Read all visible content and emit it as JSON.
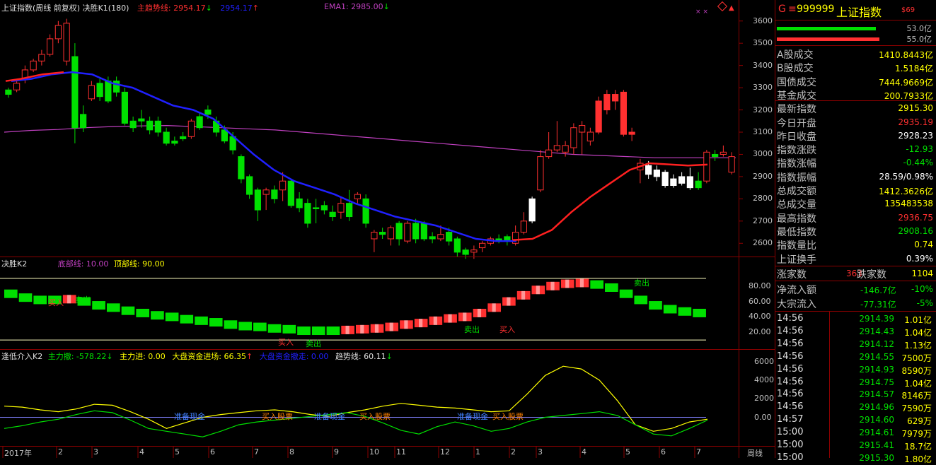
{
  "colors": {
    "up": "#ff3030",
    "down": "#00e000",
    "blue": "#2020ff",
    "magenta": "#c040c0",
    "yellow": "#ffff00",
    "grid": "#8b0000"
  },
  "main": {
    "title": "上证指数(周线 前复权) 决胜K1(180)",
    "trend_label": "主趋势线: 2954.17",
    "trend_arrow": "↓",
    "blue_label": "2954.17",
    "blue_arrow": "↑",
    "ema_label": "EMA1: 2985.00",
    "ema_arrow": "↓",
    "marker": "× ×",
    "y_ticks": [
      "3600",
      "3500",
      "3400",
      "3300",
      "3200",
      "3100",
      "3000",
      "2900",
      "2800",
      "2700",
      "2600"
    ]
  },
  "k2": {
    "title": "决胜K2",
    "bottom_label": "底部线: 10.00",
    "top_label": "顶部线: 90.00",
    "y_ticks": [
      "80.00",
      "60.00",
      "40.00",
      "20.00"
    ],
    "annotations": [
      "买入",
      "卖出",
      "买入",
      "卖出",
      "卖出",
      "买入",
      "卖出"
    ]
  },
  "k3": {
    "title": "逢低介入K2",
    "zhuli_che": "主力撤: -578.22",
    "zhuli_che_arrow": "↓",
    "zhuli_jin": "主力进: 0.00",
    "dapan_jin": "大盘资金进场: 66.35",
    "dapan_jin_arrow": "↑",
    "dapan_che": "大盘资金撤走: 0.00",
    "trend": "趋势线: 60.11",
    "trend_arrow": "↓",
    "y_ticks": [
      "6000",
      "4000",
      "2000",
      "0.00"
    ],
    "annotations": [
      "准备现金",
      "买入股票",
      "准备现金",
      "买入股票",
      "准备现金",
      "买入股票"
    ]
  },
  "x_axis": {
    "labels": [
      "2017年",
      "2",
      "3",
      "4",
      "5",
      "6",
      "7",
      "8",
      "9",
      "10",
      "11",
      "12",
      "1",
      "2",
      "3",
      "4",
      "5",
      "6",
      "7"
    ],
    "period": "周线"
  },
  "chart_data": {
    "type": "candlestick",
    "title": "上证指数(周线 前复权)",
    "ylim": [
      2550,
      3650
    ],
    "candles": [
      {
        "o": 3270,
        "c": 3290,
        "h": 3300,
        "l": 3255,
        "up": false
      },
      {
        "o": 3290,
        "c": 3320,
        "h": 3330,
        "l": 3280,
        "up": true
      },
      {
        "o": 3340,
        "c": 3380,
        "h": 3400,
        "l": 3320,
        "up": true
      },
      {
        "o": 3380,
        "c": 3420,
        "h": 3430,
        "l": 3370,
        "up": true
      },
      {
        "o": 3420,
        "c": 3450,
        "h": 3470,
        "l": 3400,
        "up": true
      },
      {
        "o": 3450,
        "c": 3520,
        "h": 3540,
        "l": 3440,
        "up": true
      },
      {
        "o": 3520,
        "c": 3580,
        "h": 3600,
        "l": 3500,
        "up": true
      },
      {
        "o": 3590,
        "c": 3420,
        "h": 3610,
        "l": 3400,
        "up": true
      },
      {
        "o": 3440,
        "c": 3120,
        "h": 3500,
        "l": 3050,
        "up": false
      },
      {
        "o": 3180,
        "c": 3120,
        "h": 3220,
        "l": 3100,
        "up": false
      },
      {
        "o": 3250,
        "c": 3310,
        "h": 3330,
        "l": 3240,
        "up": true
      },
      {
        "o": 3320,
        "c": 3260,
        "h": 3340,
        "l": 3240,
        "up": false
      },
      {
        "o": 3330,
        "c": 3240,
        "h": 3350,
        "l": 3230,
        "up": false
      },
      {
        "o": 3330,
        "c": 3280,
        "h": 3350,
        "l": 3260,
        "up": false
      },
      {
        "o": 3280,
        "c": 3140,
        "h": 3300,
        "l": 3130,
        "up": false
      },
      {
        "o": 3150,
        "c": 3120,
        "h": 3170,
        "l": 3100,
        "up": false
      },
      {
        "o": 3160,
        "c": 3150,
        "h": 3200,
        "l": 3120,
        "up": false
      },
      {
        "o": 3150,
        "c": 3110,
        "h": 3170,
        "l": 3090,
        "up": false
      },
      {
        "o": 3150,
        "c": 3100,
        "h": 3170,
        "l": 3080,
        "up": false
      },
      {
        "o": 3100,
        "c": 3050,
        "h": 3120,
        "l": 3040,
        "up": false
      },
      {
        "o": 3060,
        "c": 3050,
        "h": 3080,
        "l": 3040,
        "up": false
      },
      {
        "o": 3080,
        "c": 3070,
        "h": 3100,
        "l": 3060,
        "up": false
      },
      {
        "o": 3080,
        "c": 3150,
        "h": 3160,
        "l": 3070,
        "up": true
      },
      {
        "o": 3170,
        "c": 3120,
        "h": 3190,
        "l": 3110,
        "up": false
      },
      {
        "o": 3200,
        "c": 3180,
        "h": 3220,
        "l": 3160,
        "up": false
      },
      {
        "o": 3150,
        "c": 3100,
        "h": 3170,
        "l": 3080,
        "up": false
      },
      {
        "o": 3110,
        "c": 3060,
        "h": 3130,
        "l": 3050,
        "up": false
      },
      {
        "o": 3080,
        "c": 3020,
        "h": 3100,
        "l": 3000,
        "up": false
      },
      {
        "o": 2990,
        "c": 2890,
        "h": 3000,
        "l": 2870,
        "up": false
      },
      {
        "o": 2900,
        "c": 2820,
        "h": 2910,
        "l": 2800,
        "up": false
      },
      {
        "o": 2840,
        "c": 2750,
        "h": 2850,
        "l": 2700,
        "up": false
      },
      {
        "o": 2820,
        "c": 2840,
        "h": 2850,
        "l": 2750,
        "up": true
      },
      {
        "o": 2840,
        "c": 2800,
        "h": 2860,
        "l": 2780,
        "up": false
      },
      {
        "o": 2840,
        "c": 2880,
        "h": 2920,
        "l": 2790,
        "up": true
      },
      {
        "o": 2880,
        "c": 2770,
        "h": 2890,
        "l": 2760,
        "up": false
      },
      {
        "o": 2800,
        "c": 2760,
        "h": 2830,
        "l": 2740,
        "up": false
      },
      {
        "o": 2780,
        "c": 2690,
        "h": 2800,
        "l": 2670,
        "up": false
      },
      {
        "o": 2760,
        "c": 2760,
        "h": 2800,
        "l": 2690,
        "up": false
      },
      {
        "o": 2770,
        "c": 2750,
        "h": 2790,
        "l": 2730,
        "up": false
      },
      {
        "o": 2740,
        "c": 2720,
        "h": 2770,
        "l": 2700,
        "up": false
      },
      {
        "o": 2740,
        "c": 2780,
        "h": 2810,
        "l": 2710,
        "up": true
      },
      {
        "o": 2780,
        "c": 2720,
        "h": 2840,
        "l": 2700,
        "up": false
      },
      {
        "o": 2800,
        "c": 2820,
        "h": 2830,
        "l": 2780,
        "up": true
      },
      {
        "o": 2800,
        "c": 2690,
        "h": 2820,
        "l": 2670,
        "up": false
      },
      {
        "o": 2620,
        "c": 2650,
        "h": 2660,
        "l": 2560,
        "up": true
      },
      {
        "o": 2650,
        "c": 2640,
        "h": 2670,
        "l": 2620,
        "up": false
      },
      {
        "o": 2620,
        "c": 2670,
        "h": 2680,
        "l": 2590,
        "up": true
      },
      {
        "o": 2690,
        "c": 2620,
        "h": 2700,
        "l": 2590,
        "up": false
      },
      {
        "o": 2610,
        "c": 2690,
        "h": 2700,
        "l": 2600,
        "up": true
      },
      {
        "o": 2690,
        "c": 2620,
        "h": 2710,
        "l": 2600,
        "up": false
      },
      {
        "o": 2690,
        "c": 2620,
        "h": 2700,
        "l": 2610,
        "up": false
      },
      {
        "o": 2630,
        "c": 2620,
        "h": 2650,
        "l": 2600,
        "up": false
      },
      {
        "o": 2620,
        "c": 2640,
        "h": 2680,
        "l": 2610,
        "up": true
      },
      {
        "o": 2650,
        "c": 2610,
        "h": 2670,
        "l": 2590,
        "up": false
      },
      {
        "o": 2620,
        "c": 2560,
        "h": 2630,
        "l": 2540,
        "up": false
      },
      {
        "o": 2570,
        "c": 2550,
        "h": 2580,
        "l": 2530,
        "up": false
      },
      {
        "o": 2560,
        "c": 2570,
        "h": 2590,
        "l": 2530,
        "up": true
      },
      {
        "o": 2580,
        "c": 2600,
        "h": 2610,
        "l": 2560,
        "up": true
      },
      {
        "o": 2600,
        "c": 2620,
        "h": 2630,
        "l": 2590,
        "up": true
      },
      {
        "o": 2620,
        "c": 2620,
        "h": 2640,
        "l": 2600,
        "up": false
      },
      {
        "o": 2630,
        "c": 2610,
        "h": 2640,
        "l": 2590,
        "up": false
      },
      {
        "o": 2600,
        "c": 2650,
        "h": 2680,
        "l": 2590,
        "up": true
      },
      {
        "o": 2650,
        "c": 2700,
        "h": 2740,
        "l": 2640,
        "up": true
      },
      {
        "o": 2700,
        "c": 2800,
        "h": 2810,
        "l": 2690,
        "up": true
      },
      {
        "o": 2840,
        "c": 2990,
        "h": 3020,
        "l": 2830,
        "up": true
      },
      {
        "o": 2990,
        "c": 3020,
        "h": 3100,
        "l": 2980,
        "up": true
      },
      {
        "o": 3020,
        "c": 3040,
        "h": 3150,
        "l": 3010,
        "up": true
      },
      {
        "o": 3040,
        "c": 3010,
        "h": 3060,
        "l": 2990,
        "up": true
      },
      {
        "o": 3030,
        "c": 3120,
        "h": 3140,
        "l": 3000,
        "up": true
      },
      {
        "o": 3100,
        "c": 3130,
        "h": 3150,
        "l": 3000,
        "up": true
      },
      {
        "o": 3100,
        "c": 3060,
        "h": 3120,
        "l": 3040,
        "up": true
      },
      {
        "o": 3100,
        "c": 3240,
        "h": 3260,
        "l": 3090,
        "up": true
      },
      {
        "o": 3200,
        "c": 3270,
        "h": 3290,
        "l": 3180,
        "up": true
      },
      {
        "o": 3270,
        "c": 3240,
        "h": 3290,
        "l": 3200,
        "up": true
      },
      {
        "o": 3280,
        "c": 3090,
        "h": 3290,
        "l": 3080,
        "up": true
      },
      {
        "o": 3100,
        "c": 3090,
        "h": 3120,
        "l": 3060,
        "up": true
      },
      {
        "o": 2960,
        "c": 2930,
        "h": 2980,
        "l": 2870,
        "up": true
      },
      {
        "o": 2950,
        "c": 2910,
        "h": 2970,
        "l": 2890,
        "up": false
      },
      {
        "o": 2930,
        "c": 2900,
        "h": 2950,
        "l": 2880,
        "up": false
      },
      {
        "o": 2920,
        "c": 2860,
        "h": 2930,
        "l": 2850,
        "up": false
      },
      {
        "o": 2890,
        "c": 2860,
        "h": 2910,
        "l": 2850,
        "up": false
      },
      {
        "o": 2900,
        "c": 2870,
        "h": 2920,
        "l": 2860,
        "up": false
      },
      {
        "o": 2850,
        "c": 2900,
        "h": 2940,
        "l": 2840,
        "up": false
      },
      {
        "o": 2850,
        "c": 2880,
        "h": 2920,
        "l": 2840,
        "up": false
      },
      {
        "o": 2880,
        "c": 3010,
        "h": 3020,
        "l": 2870,
        "up": true
      },
      {
        "o": 3000,
        "c": 2990,
        "h": 3020,
        "l": 2970,
        "up": false
      },
      {
        "o": 3010,
        "c": 3000,
        "h": 3040,
        "l": 2990,
        "up": true
      },
      {
        "o": 2990,
        "c": 2920,
        "h": 3010,
        "l": 2910,
        "up": true
      }
    ],
    "ema1": [
      3100,
      3108,
      3112,
      3120,
      3125,
      3128,
      3130,
      3125,
      3120,
      3115,
      3110,
      3100,
      3090,
      3080,
      3070,
      3060,
      3050,
      3040,
      3030,
      3020,
      3010,
      3000,
      2995,
      2990,
      2985,
      2985,
      2985,
      2985
    ],
    "trend_blue": [
      3330,
      3340,
      3360,
      3370,
      3360,
      3320,
      3300,
      3260,
      3220,
      3200,
      3160,
      3080,
      3000,
      2930,
      2880,
      2850,
      2820,
      2780,
      2750,
      2720,
      2700,
      2680,
      2650,
      2620,
      2610,
      2610
    ],
    "trend_red": [
      3330,
      3340,
      3360,
      3370,
      2615,
      2620,
      2660,
      2740,
      2810,
      2870,
      2930,
      2960,
      2955,
      2950,
      2954
    ],
    "k2_values": [
      70,
      65,
      62,
      62,
      63,
      60,
      55,
      52,
      48,
      45,
      42,
      40,
      37,
      35,
      33,
      30,
      28,
      27,
      25,
      24,
      22,
      22,
      22,
      23,
      24,
      25,
      27,
      30,
      32,
      35,
      38,
      40,
      45,
      52,
      60,
      68,
      75,
      80,
      83,
      84,
      82,
      78,
      70,
      62,
      55,
      50,
      47,
      45
    ],
    "k3_zhuli": [
      1200,
      1100,
      800,
      600,
      900,
      1400,
      1300,
      600,
      -200,
      -1200,
      -600,
      0,
      300,
      500,
      700,
      800,
      600,
      300,
      100,
      500,
      800,
      1200,
      1500,
      1300,
      1100,
      1000,
      800,
      600,
      700,
      2500,
      4500,
      5500,
      5200,
      4000,
      1800,
      -800,
      -1500,
      -1200,
      -500,
      -200
    ],
    "k3_green": [
      -1200,
      -900,
      -500,
      -200,
      300,
      700,
      500,
      -300,
      -1200,
      -1500,
      -1800,
      -2100,
      -1500,
      -800,
      -500,
      -300,
      -100,
      100,
      300,
      500,
      100,
      -600,
      -1400,
      -1800,
      -1000,
      -500,
      -900,
      -1500,
      -1200,
      -500,
      0,
      200,
      400,
      600,
      200,
      -800,
      -1800,
      -2000,
      -1200,
      -300
    ]
  },
  "right_panel": {
    "code": "999999",
    "name": "上证指数",
    "g_icon": "G",
    "menu_icon": "≡",
    "sub": "$69",
    "bar1_value": "53.0亿",
    "bar2_value": "55.0亿",
    "stats": [
      {
        "k": "A股成交",
        "v": "1410.8443亿",
        "c": "#ffff00"
      },
      {
        "k": "B股成交",
        "v": "1.5184亿",
        "c": "#ffff00"
      },
      {
        "k": "国债成交",
        "v": "7444.9669亿",
        "c": "#ffff00"
      },
      {
        "k": "基金成交",
        "v": "200.7933亿",
        "c": "#ffff00"
      },
      {
        "k": "最新指数",
        "v": "2915.30",
        "c": "#ffff00"
      },
      {
        "k": "今日开盘",
        "v": "2935.19",
        "c": "#ff3030"
      },
      {
        "k": "昨日收盘",
        "v": "2928.23",
        "c": "#ffffff"
      },
      {
        "k": "指数涨跌",
        "v": "-12.93",
        "c": "#00e000"
      },
      {
        "k": "指数涨幅",
        "v": "-0.44%",
        "c": "#00e000"
      },
      {
        "k": "指数振幅",
        "v": "28.59/0.98%",
        "c": "#ffffff"
      },
      {
        "k": "总成交额",
        "v": "1412.3626亿",
        "c": "#ffff00"
      },
      {
        "k": "总成交量",
        "v": "135483538",
        "c": "#ffff00"
      },
      {
        "k": "最高指数",
        "v": "2936.75",
        "c": "#ff3030"
      },
      {
        "k": "最低指数",
        "v": "2908.16",
        "c": "#00e000"
      },
      {
        "k": "指数量比",
        "v": "0.74",
        "c": "#ffff00"
      },
      {
        "k": "上证换手",
        "v": "0.39%",
        "c": "#ffffff"
      }
    ],
    "zhang_label": "涨家数",
    "zhang_value": "363",
    "die_label": "跌家数",
    "die_value": "1104",
    "flows": [
      {
        "k": "净流入额",
        "v": "-146.7亿",
        "p": "-10%"
      },
      {
        "k": "大宗流入",
        "v": "-77.31亿",
        "p": "-5%"
      }
    ],
    "ticks": [
      {
        "t": "14:56",
        "p": "2914.39",
        "v": "1.01亿"
      },
      {
        "t": "14:56",
        "p": "2914.43",
        "v": "1.04亿"
      },
      {
        "t": "14:56",
        "p": "2914.12",
        "v": "1.13亿"
      },
      {
        "t": "14:56",
        "p": "2914.55",
        "v": "7500万"
      },
      {
        "t": "14:56",
        "p": "2914.93",
        "v": "8590万"
      },
      {
        "t": "14:56",
        "p": "2914.75",
        "v": "1.04亿"
      },
      {
        "t": "14:56",
        "p": "2914.57",
        "v": "8146万"
      },
      {
        "t": "14:56",
        "p": "2914.96",
        "v": "7590万"
      },
      {
        "t": "14:57",
        "p": "2914.60",
        "v": "629万"
      },
      {
        "t": "15:00",
        "p": "2914.61",
        "v": "7979万"
      },
      {
        "t": "15:00",
        "p": "2915.41",
        "v": "18.7亿"
      },
      {
        "t": "15:00",
        "p": "2915.30",
        "v": "1.80亿"
      }
    ]
  }
}
